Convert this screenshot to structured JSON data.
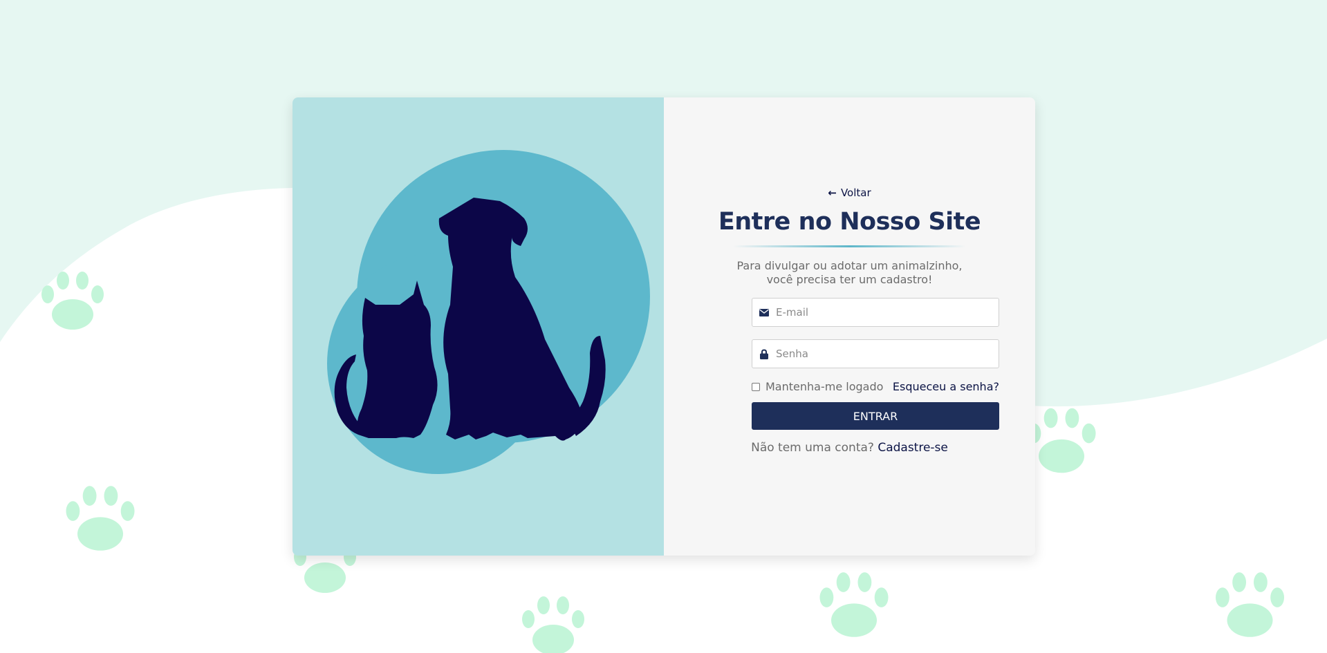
{
  "colors": {
    "page_top": "#e6f7f2",
    "paw": "#c3f5d9",
    "illustration_bg": "#b4e1e3",
    "circle": "#5db8cc",
    "silhouette": "#0c0648",
    "form_bg": "#f6f6f6",
    "primary": "#1e2f5a",
    "link": "#0c1445",
    "muted_text": "#6b6b6b"
  },
  "illustration": {
    "image": "cat-and-dog-silhouette",
    "icon": "pet-silhouette-icon"
  },
  "login": {
    "back_label": "Voltar",
    "back_icon": "arrow-left-icon",
    "title": "Entre no Nosso Site",
    "subtitle_line1": "Para divulgar ou adotar um animalzinho,",
    "subtitle_line2": "você precisa ter um cadastro!",
    "email": {
      "placeholder": "E-mail",
      "value": "",
      "icon": "envelope-icon"
    },
    "password": {
      "placeholder": "Senha",
      "value": "",
      "icon": "lock-icon"
    },
    "remember_label": "Mantenha-me logado",
    "remember_checked": false,
    "forgot_label": "Esqueceu a senha?",
    "submit_label": "ENTRAR",
    "signup_prompt": "Não tem uma conta?",
    "signup_link": "Cadastre-se"
  }
}
